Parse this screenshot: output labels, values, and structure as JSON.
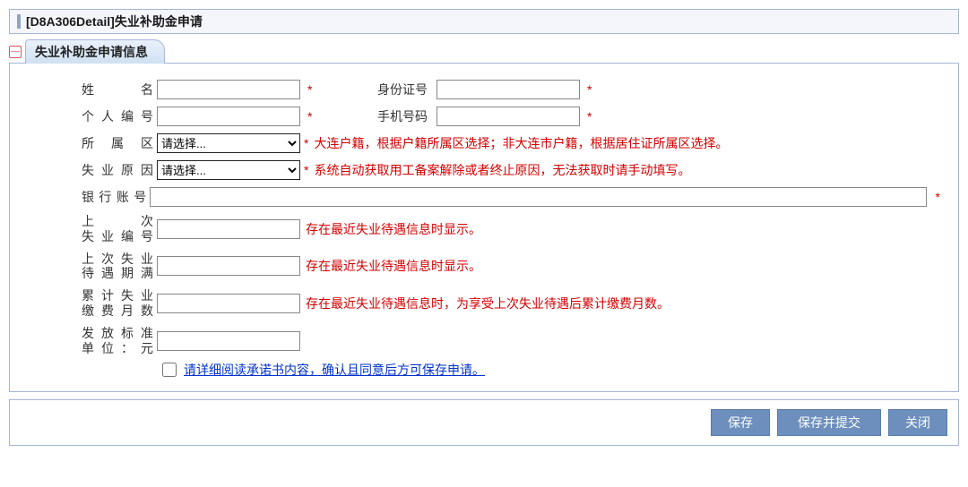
{
  "header": {
    "title": "[D8A306Detail]失业补助金申请"
  },
  "section": {
    "title": "失业补助金申请信息"
  },
  "fields": {
    "name": {
      "label": "姓　　名",
      "value": ""
    },
    "idcard": {
      "label": "身份证号",
      "value": ""
    },
    "personal_no": {
      "label": "个人编号",
      "value": ""
    },
    "phone": {
      "label": "手机号码",
      "value": ""
    },
    "district": {
      "label": "所 属 区",
      "selected": "请选择...",
      "hint": "大连户籍，根据户籍所属区选择；非大连市户籍，根据居住证所属区选择。"
    },
    "unemp_reason": {
      "label": "失业原因",
      "selected": "请选择...",
      "hint": "系统自动获取用工备案解除或者终止原因，无法获取时请手动填写。"
    },
    "bank_acc": {
      "label": "银行账号",
      "value": ""
    },
    "last_unemp_no": {
      "label": "上　　次\n失业编号",
      "value": "",
      "hint": "存在最近失业待遇信息时显示。"
    },
    "last_unemp_expire": {
      "label": "上次失业\n待遇期满",
      "value": "",
      "hint": "存在最近失业待遇信息时显示。"
    },
    "cum_months": {
      "label": "累计失业\n缴费月数",
      "value": "",
      "hint": "存在最近失业待遇信息时，为享受上次失业待遇后累计缴费月数。"
    },
    "pay_standard": {
      "label": "发放标准\n单位：元",
      "value": ""
    }
  },
  "agree": {
    "link_text": "请详细阅读承诺书内容，确认且同意后方可保存申请。",
    "checked": false
  },
  "req_mark": "*",
  "buttons": {
    "save": "保存",
    "save_submit": "保存并提交",
    "close": "关闭"
  }
}
